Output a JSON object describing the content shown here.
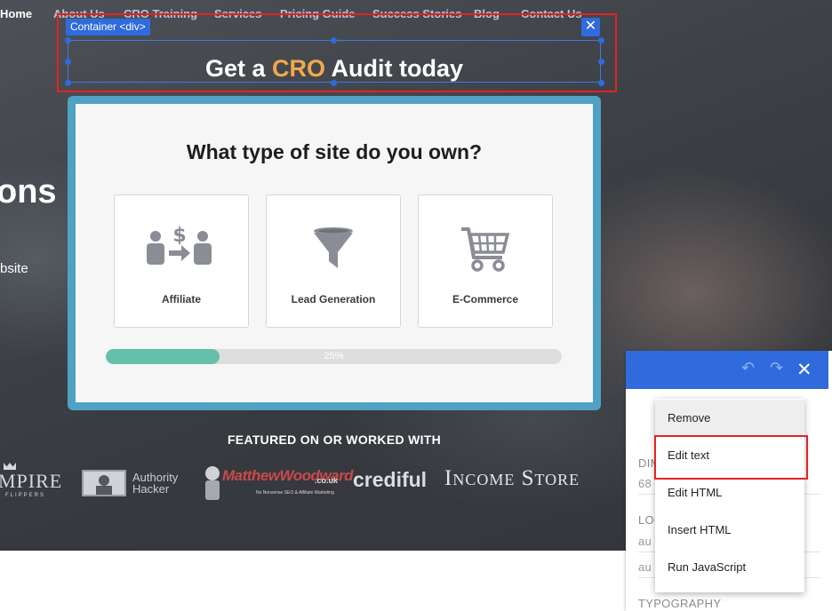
{
  "nav": {
    "items": [
      "Home",
      "About Us",
      "CRO Training",
      "Services",
      "Pricing Guide",
      "Success Stories",
      "Blog",
      "Contact Us"
    ]
  },
  "hero": {
    "heading_fragment": "ons",
    "sub_fragment": "bsite"
  },
  "selection": {
    "tag": "Container <div>",
    "close_icon": "close-icon"
  },
  "cta": {
    "prefix": "Get a ",
    "accent": "CRO",
    "suffix": " Audit today"
  },
  "quiz": {
    "question": "What type of site do you own?",
    "options": [
      {
        "label": "Affiliate",
        "icon": "affiliate-icon"
      },
      {
        "label": "Lead Generation",
        "icon": "funnel-icon"
      },
      {
        "label": "E-Commerce",
        "icon": "shopping-cart-icon"
      }
    ],
    "progress_percent": 25,
    "progress_text": "25%"
  },
  "featured": {
    "heading": "FEATURED ON OR WORKED WITH",
    "logos": {
      "empire_main": "MPIRE",
      "empire_sub": "FLIPPERS",
      "authority_line1": "Authority",
      "authority_line2": "Hacker",
      "mw_main": "MatthewWoodward",
      "mw_tld": ".co.uk",
      "mw_tagline": "No Nonsense SEO & Affiliate Marketing",
      "crediful": "crediful",
      "income_store": "Income Store"
    }
  },
  "panel": {
    "undo_icon": "undo-icon",
    "redo_icon": "redo-icon",
    "dim_label": "DIM",
    "dim_value": "68",
    "loc_label": "LOC",
    "loc_value1": "au",
    "loc_value2": "au",
    "typography_label": "TYPOGRAPHY"
  },
  "context_menu": {
    "items": [
      "Remove",
      "Edit text",
      "Edit HTML",
      "Insert HTML",
      "Run JavaScript"
    ]
  },
  "colors": {
    "accent_orange": "#f2a94b",
    "selection_blue": "#2f6bdc",
    "highlight_red": "#e02424",
    "progress_green": "#66bfa9",
    "quiz_frame": "#4fa2c4"
  }
}
